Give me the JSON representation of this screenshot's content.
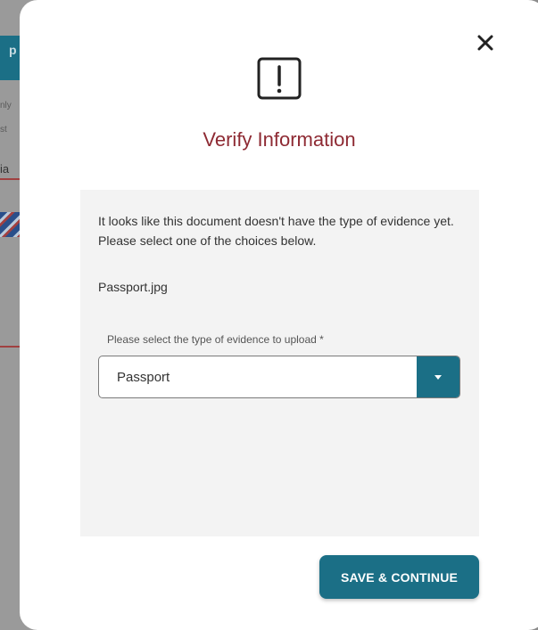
{
  "background": {
    "tab_letter": "p",
    "fragments": [
      "nly",
      "st",
      "ia"
    ]
  },
  "modal": {
    "close_icon": "close-icon",
    "alert_icon": "exclamation-square-icon",
    "title": "Verify Information",
    "message": "It looks like this document doesn't have the type of evidence yet. Please select one of the choices below.",
    "filename": "Passport.jpg",
    "select": {
      "label": "Please select the type of evidence to upload *",
      "value": "Passport",
      "arrow_icon": "caret-down-icon"
    },
    "save_button": "SAVE & CONTINUE"
  },
  "colors": {
    "accent": "#1b6f86",
    "title": "#8e2a33",
    "panel": "#f3f3f3"
  }
}
